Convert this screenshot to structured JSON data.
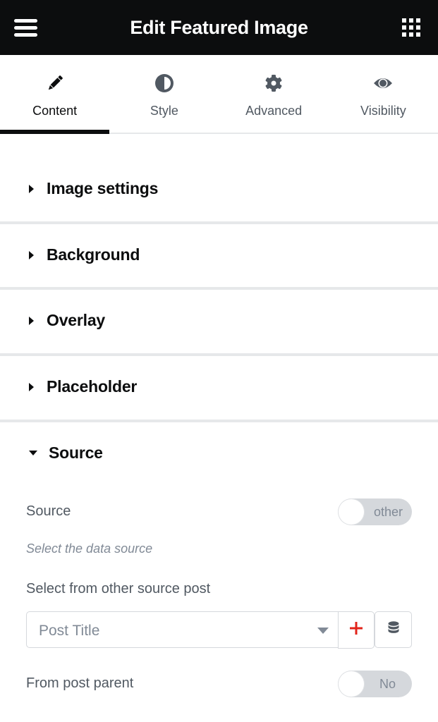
{
  "header": {
    "title": "Edit Featured Image",
    "menu_icon": "hamburger-icon",
    "apps_icon": "grid-icon"
  },
  "tabs": [
    {
      "label": "Content",
      "icon": "pencil-icon",
      "active": true
    },
    {
      "label": "Style",
      "icon": "half-circle-icon",
      "active": false
    },
    {
      "label": "Advanced",
      "icon": "gear-icon",
      "active": false
    },
    {
      "label": "Visibility",
      "icon": "eye-icon",
      "active": false
    }
  ],
  "sections": [
    {
      "title": "Image settings",
      "expanded": false
    },
    {
      "title": "Background",
      "expanded": false
    },
    {
      "title": "Overlay",
      "expanded": false
    },
    {
      "title": "Placeholder",
      "expanded": false
    },
    {
      "title": "Source",
      "expanded": true
    }
  ],
  "source_panel": {
    "source_label": "Source",
    "source_toggle_text": "other",
    "source_toggle_on": false,
    "source_description": "Select the data source",
    "other_post_label": "Select from other source post",
    "post_select_value": "Post Title",
    "add_button_icon": "plus-icon",
    "dynamic_button_icon": "database-icon",
    "post_parent_label": "From post parent",
    "post_parent_toggle_text": "No",
    "post_parent_toggle_on": false
  },
  "colors": {
    "header_bg": "#0c0d0e",
    "accent_red": "#e2231a",
    "divider": "#e6e8ea",
    "muted_text": "#818a96"
  }
}
